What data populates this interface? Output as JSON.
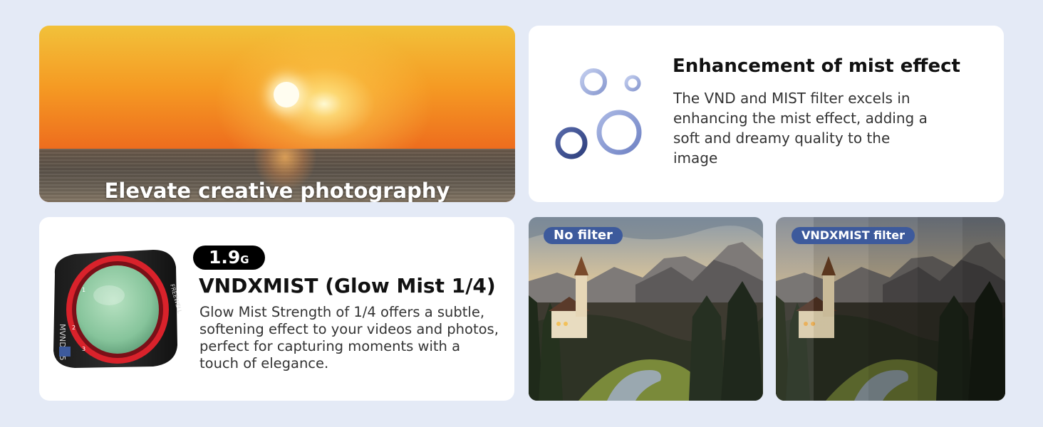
{
  "sunset_card": {
    "caption": "Elevate creative photography"
  },
  "mist_card": {
    "title": "Enhancement of mist effect",
    "body": "The VND and MIST filter excels in enhancing the mist effect, adding a soft and dreamy quality to the image",
    "icon": "bubbles-icon",
    "colors": {
      "bubble_light": "#9fb0dc",
      "bubble_dark": "#3d5190"
    }
  },
  "product_card": {
    "weight_value": "1.9",
    "weight_unit": "G",
    "title": "VNDXMIST (Glow Mist 1/4)",
    "body": "Glow Mist Strength of 1/4 offers a subtle, softening effect to your videos and photos, perfect for capturing moments with a touch of elegance.",
    "lens_markings": {
      "model": "MVND1-5",
      "brand": "FREEWELL",
      "scale": [
        "1",
        "2",
        "3"
      ]
    },
    "colors": {
      "ring": "#d9222b",
      "glass": "#8fc9a0"
    }
  },
  "comparison": {
    "no_filter_label": "No filter",
    "filter_label": "VNDXMIST filter",
    "pill_color": "#3d5a9c"
  }
}
